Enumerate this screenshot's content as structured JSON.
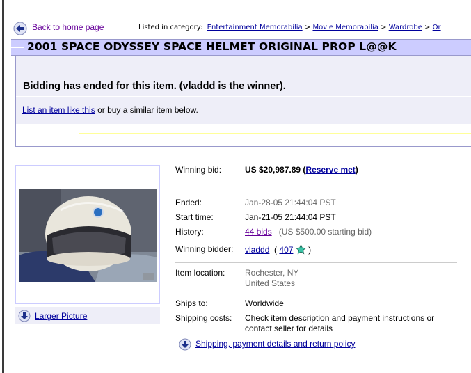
{
  "nav": {
    "back_label": "Back to home page",
    "listed_label": "Listed in category:",
    "categories": [
      "Entertainment Memorabilia",
      "Movie Memorabilia",
      "Wardrobe",
      "Or"
    ],
    "separator": ">"
  },
  "item": {
    "title": "2001 SPACE ODYSSEY SPACE HELMET ORIGINAL PROP L@@K"
  },
  "status": {
    "ended_text": "Bidding has ended for this item.  (vladdd is the winner).",
    "list_link": "List an item like this",
    "list_suffix": "or buy a similar item below."
  },
  "photo": {
    "larger_link": "Larger Picture"
  },
  "details": {
    "winning_bid_label": "Winning bid:",
    "winning_bid_value": "US $20,987.89",
    "reserve_open": "(",
    "reserve_link": "Reserve met",
    "reserve_close": ")",
    "ended_label": "Ended:",
    "ended_value": "Jan-28-05 21:44:04 PST",
    "start_label": "Start time:",
    "start_value": "Jan-21-05 21:44:04 PST",
    "history_label": "History:",
    "history_link": "44 bids",
    "history_note": "(US $500.00 starting bid)",
    "winner_label": "Winning bidder:",
    "winner_link": "vladdd",
    "feedback_open": "(",
    "feedback_link": "407",
    "feedback_close": ")",
    "location_label": "Item location:",
    "location_city": "Rochester, NY",
    "location_country": "United States",
    "ships_label": "Ships to:",
    "ships_value": "Worldwide",
    "costs_label": "Shipping costs:",
    "costs_line1": "Check item description and payment instructions or",
    "costs_line2": "contact seller for details",
    "policy_link": "Shipping, payment details and return policy"
  },
  "colors": {
    "title_bar": "#ccccff",
    "panel": "#eeeef8",
    "link": "#00009c",
    "visited": "#660099"
  }
}
